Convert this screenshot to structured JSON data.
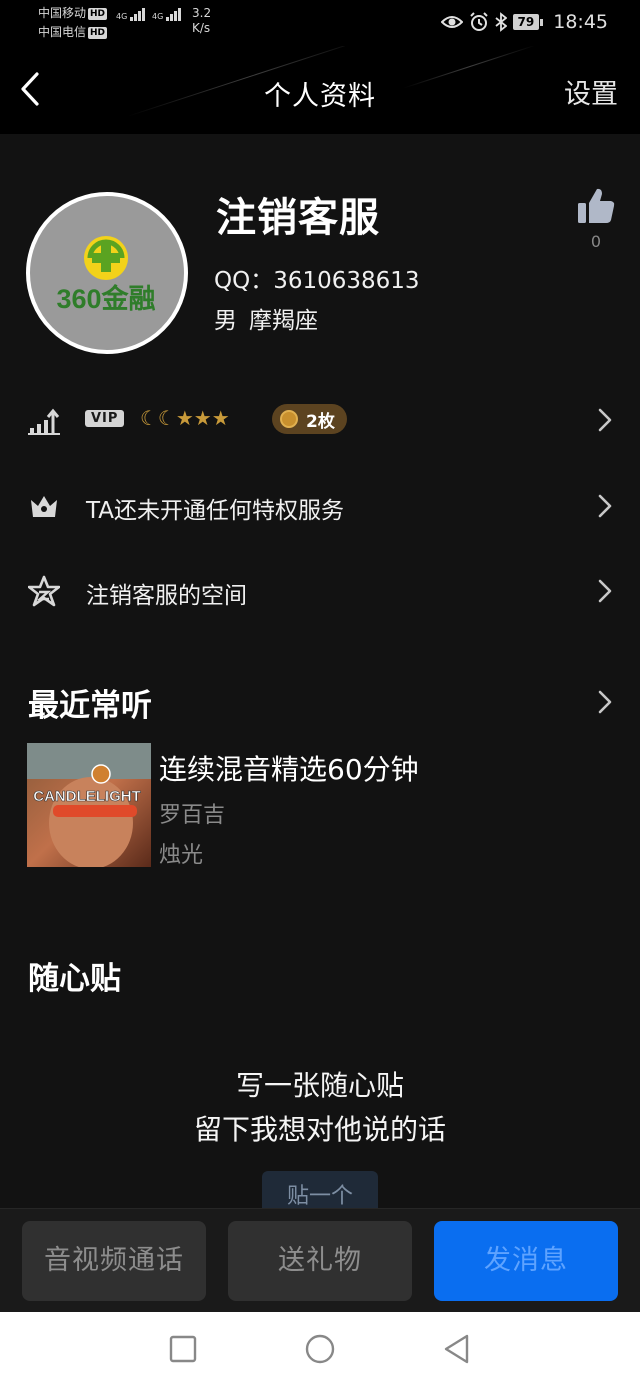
{
  "status_bar": {
    "carrier_1": "中国移动",
    "carrier_2": "中国电信",
    "hd_label": "HD",
    "network_type": "4G",
    "net_speed_value": "3.2",
    "net_speed_unit": "K/s",
    "battery_level": "79",
    "time": "18:45"
  },
  "header": {
    "title": "个人资料",
    "settings_label": "设置",
    "back_icon": "chevron-left-icon"
  },
  "profile": {
    "nickname": "注销客服",
    "qq_label": "QQ：",
    "qq_number": "3610638613",
    "gender": "男",
    "zodiac": "摩羯座",
    "like_count": "0",
    "avatar_logo_text": "360金融"
  },
  "rows": {
    "level": {
      "vip_label": "VIP",
      "level_icons": "☾☾★★★",
      "coin_count": "2枚"
    },
    "privilege": {
      "label": "TA还未开通任何特权服务"
    },
    "space": {
      "label": "注销客服的空间"
    }
  },
  "recent": {
    "section_title": "最近常听",
    "song_title": "连续混音精选60分钟",
    "artist": "罗百吉",
    "album": "烛光",
    "album_cover_text": "CANDLELIGHT"
  },
  "sticky_note": {
    "section_title": "随心贴",
    "line_1": "写一张随心贴",
    "line_2": "留下我想对他说的话",
    "post_button": "贴一个"
  },
  "action_bar": {
    "call_label": "音视频通话",
    "gift_label": "送礼物",
    "message_label": "发消息"
  },
  "colors": {
    "background": "#121212",
    "accent_blue": "#0a6ef0",
    "coin_gold": "#c8902e"
  }
}
